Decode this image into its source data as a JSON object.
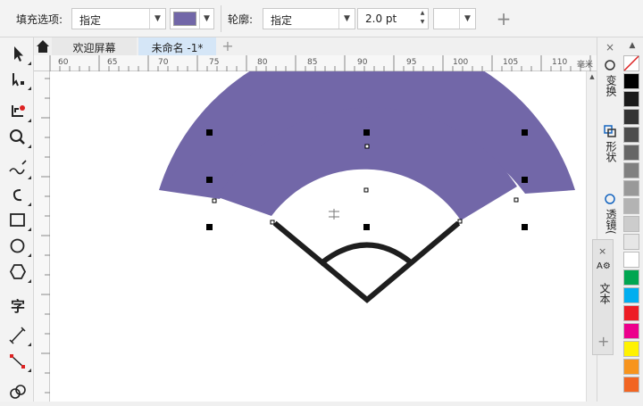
{
  "property_bar": {
    "fill_label": "填充选项:",
    "fill_value": "指定",
    "fill_color": "#7267a8",
    "outline_label": "轮廓:",
    "outline_value": "指定",
    "outline_width": "2.0 pt"
  },
  "tabs": {
    "welcome": "欢迎屏幕",
    "document": "未命名 -1*"
  },
  "ruler": {
    "numbers": [
      "60",
      "65",
      "70",
      "75",
      "80",
      "85",
      "90",
      "95",
      "100",
      "105",
      "110"
    ],
    "unit": "毫米"
  },
  "dock": {
    "transform": "变换",
    "shape": "形状",
    "transparency": "透镜(",
    "text": "文本"
  },
  "toolbox": {
    "text_tool_glyph": "字"
  },
  "palette": {
    "colors": [
      "#ffffff",
      "#000000",
      "#1a1a1a",
      "#333333",
      "#4d4d4d",
      "#666666",
      "#808080",
      "#999999",
      "#b3b3b3",
      "#cccccc",
      "#e6e6e6",
      "#ffffff",
      "#00a651",
      "#00aeef",
      "#ed1c24",
      "#ec008c",
      "#fff200",
      "#f7941d",
      "#f26522"
    ]
  },
  "colors": {
    "fan_fill": "#7267a8",
    "outline": "#1e1e1e"
  }
}
